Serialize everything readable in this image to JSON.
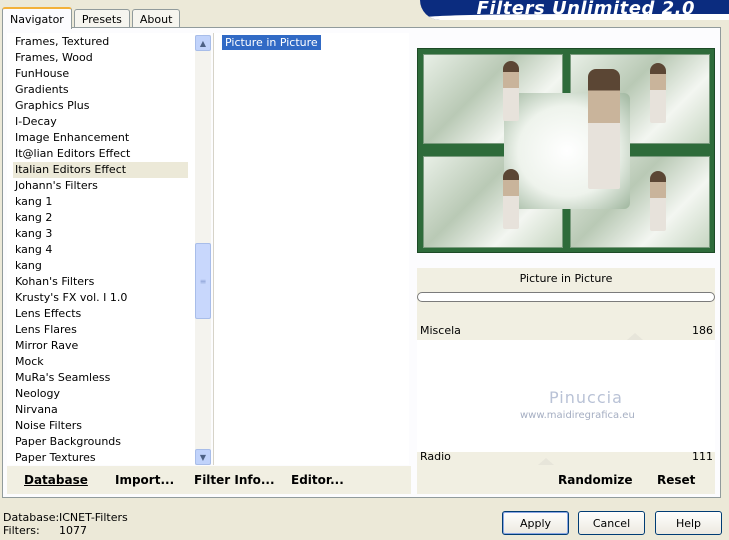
{
  "app_title": "Filters Unlimited 2.0",
  "tabs": [
    {
      "label": "Navigator",
      "active": true
    },
    {
      "label": "Presets",
      "active": false
    },
    {
      "label": "About",
      "active": false
    }
  ],
  "categories": [
    "Frames, Textured",
    "Frames, Wood",
    "FunHouse",
    "Gradients",
    "Graphics Plus",
    "I-Decay",
    "Image Enhancement",
    "It@lian Editors Effect",
    "Italian Editors Effect",
    "Johann's Filters",
    "kang 1",
    "kang 2",
    "kang 3",
    "kang 4",
    "kang",
    "Kohan's Filters",
    "Krusty's FX vol. I 1.0",
    "Lens Effects",
    "Lens Flares",
    "Mirror Rave",
    "Mock",
    "MuRa's Seamless",
    "Neology",
    "Nirvana",
    "Noise Filters",
    "Paper Backgrounds",
    "Paper Textures"
  ],
  "selected_category": "Italian Editors Effect",
  "filters": [
    "Picture in Picture"
  ],
  "selected_filter": "Picture in Picture",
  "settings": {
    "filter_name": "Picture in Picture",
    "sliders": [
      {
        "label": "Miscela",
        "value": 186
      },
      {
        "label": "Radio",
        "value": 111
      }
    ],
    "randomize": "Randomize",
    "reset": "Reset"
  },
  "watermark": {
    "line1": "Pinuccia",
    "line2": "www.maidiregrafica.eu"
  },
  "left_buttons": {
    "database": "Database",
    "import": "Import...",
    "filter_info": "Filter Info...",
    "editor": "Editor..."
  },
  "footer": {
    "database_label": "Database:",
    "database_value": "ICNET-Filters",
    "filters_label": "Filters:",
    "filters_value": "1077"
  },
  "buttons": {
    "apply": "Apply",
    "cancel": "Cancel",
    "help": "Help"
  },
  "colors": {
    "banner": "#0b2c7f",
    "selection": "#316ac5",
    "preview_frame": "#2e6b3a"
  }
}
